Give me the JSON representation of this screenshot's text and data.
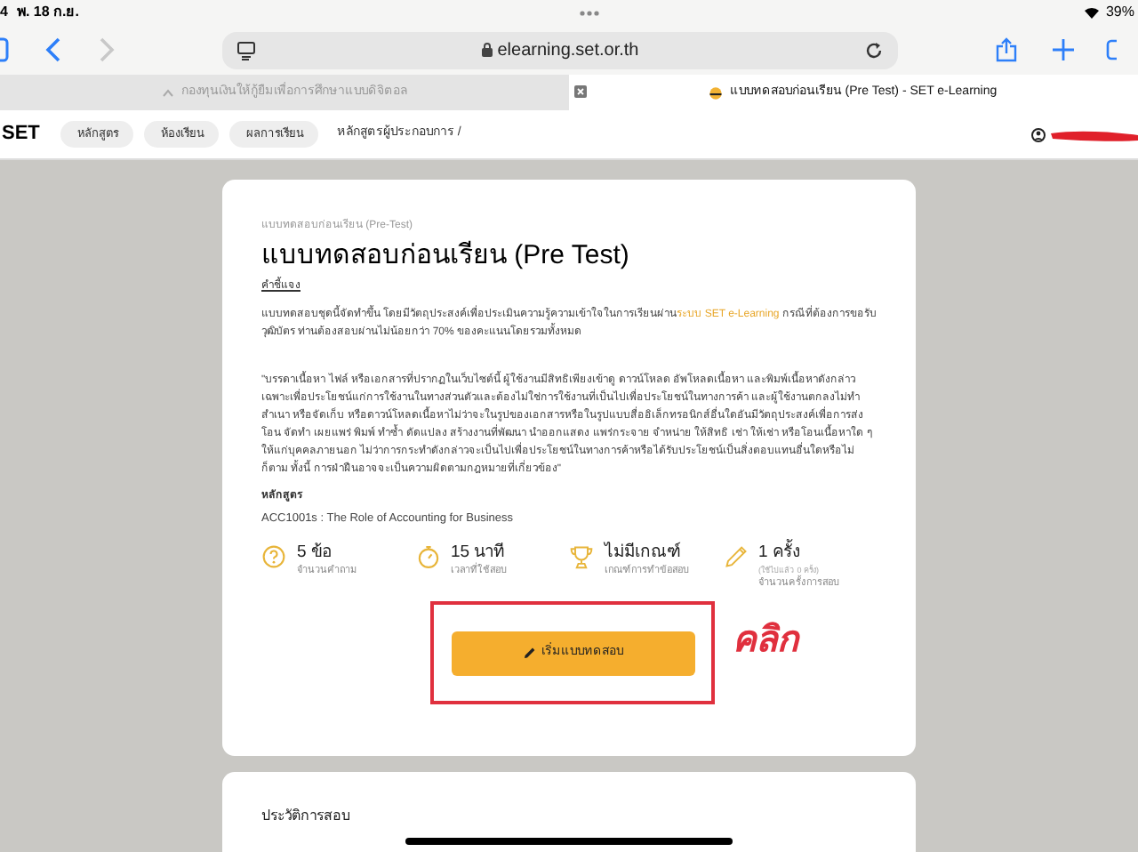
{
  "status_bar": {
    "time": "4",
    "date": "พ. 18 ก.ย.",
    "battery": "39%"
  },
  "browser": {
    "url": "elearning.set.or.th",
    "back_disabled": false,
    "forward_disabled": true,
    "tabs": [
      {
        "label": "กองทุนเงินให้กู้ยืมเพื่อการศึกษาแบบดิจิตอล",
        "selected": false
      },
      {
        "label": "แบบทดสอบก่อนเรียน (Pre Test) - SET e-Learning",
        "selected": true
      }
    ]
  },
  "site_nav": {
    "logo": "SET",
    "items": [
      {
        "label": "หลักสูตร"
      },
      {
        "label": "ห้องเรียน"
      },
      {
        "label": "ผลการเรียน"
      }
    ],
    "breadcrumb": "หลักสูตรผู้ประกอบการ /"
  },
  "exam_card": {
    "breadcrumb": "แบบทดสอบก่อนเรียน (Pre-Test)",
    "title": "แบบทดสอบก่อนเรียน (Pre Test)",
    "instructions_label": "คำชี้แจง",
    "intro": {
      "before": "แบบทดสอบชุดนี้จัดทำขึ้น โดยมีวัตถุประสงค์เพื่อประเมินความรู้ความเข้าใจในการเรียนผ่าน",
      "link": "ระบบ SET e-Learning",
      "after": " กรณีที่ต้องการขอรับวุฒิบัตร ท่านต้องสอบผ่านไม่น้อยกว่า 70% ของคะแนนโดยรวมทั้งหมด"
    },
    "notice": "\"บรรดาเนื้อหา ไฟล์ หรือเอกสารที่ปรากฏในเว็บไซต์นี้ ผู้ใช้งานมีสิทธิเพียงเข้าดู ดาวน์โหลด อัพโหลดเนื้อหา และพิมพ์เนื้อหาดังกล่าว เฉพาะเพื่อประโยชน์แก่การใช้งานในทางส่วนตัวและต้องไม่ใช่การใช้งานที่เป็นไปเพื่อประโยชน์ในทางการค้า และผู้ใช้งานตกลงไม่ทำสำเนา หรือจัดเก็บ หรือดาวน์โหลดเนื้อหาไม่ว่าจะในรูปของเอกสารหรือในรูปแบบสื่ออิเล็กทรอนิกส์อื่นใดอันมีวัตถุประสงค์เพื่อการส่ง โอน จัดทำ เผยแพร่ พิมพ์ ทำซ้ำ ดัดแปลง สร้างงานที่พัฒนา นำออกแสดง แพร่กระจาย จำหน่าย ให้สิทธิ เช่า ให้เช่า หรือโอนเนื้อหาใด ๆ ให้แก่บุคคลภายนอก ไม่ว่าการกระทำดังกล่าวจะเป็นไปเพื่อประโยชน์ในทางการค้าหรือได้รับประโยชน์เป็นสิ่งตอบแทนอื่นใดหรือไม่ก็ตาม ทั้งนี้ การฝ่าฝืนอาจจะเป็นความผิดตามกฎหมายที่เกี่ยวข้อง\"",
    "course_label": "หลักสูตร",
    "course": "ACC1001s : The Role of Accounting for Business",
    "stats": [
      {
        "kind": "question",
        "value": "5 ข้อ",
        "caption": "จำนวนคำถาม"
      },
      {
        "kind": "timer",
        "value": "15 นาที",
        "caption": "เวลาที่ใช้สอบ"
      },
      {
        "kind": "trophy",
        "value": "ไม่มีเกณฑ์",
        "caption": "เกณฑ์การทำข้อสอบ"
      },
      {
        "kind": "pencil",
        "value": "1 ครั้ง",
        "note": "(ใช้ไปแล้ว 0 ครั้ง)",
        "caption": "จำนวนครั้งการสอบ"
      }
    ],
    "start_button": "เริ่มแบบทดสอบ",
    "annotation": "คลิก"
  },
  "history_card": {
    "title": "ประวัติการสอบ"
  }
}
